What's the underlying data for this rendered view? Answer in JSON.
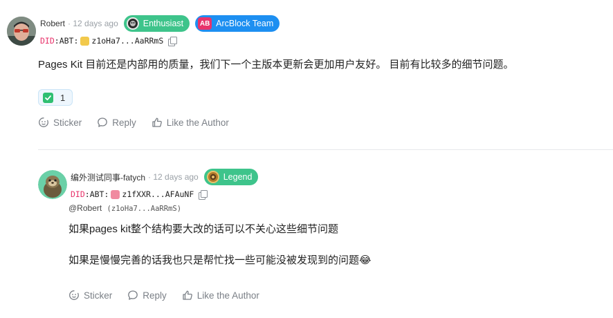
{
  "comment1": {
    "author": "Robert",
    "time": "· 12 days ago",
    "badges": [
      {
        "label": "Enthusiast",
        "color": "#3ec48b"
      },
      {
        "label": "ArcBlock Team",
        "color": "#1d8ff1",
        "icon_text": "AB"
      }
    ],
    "did": {
      "prefix": "DID",
      "middle": ":ABT:",
      "address": "z1oHa7...AaRRmS"
    },
    "body": "Pages Kit 目前还是内部用的质量，我们下一个主版本更新会更加用户友好。 目前有比较多的细节问题。",
    "reaction": {
      "icon": "check-mark-emoji",
      "count": "1"
    },
    "actions": {
      "sticker": "Sticker",
      "reply": "Reply",
      "like": "Like the Author"
    }
  },
  "comment2": {
    "author": "编外测试同事-fatych",
    "time": "· 12 days ago",
    "badges": [
      {
        "label": "Legend",
        "color": "#3ec48b"
      }
    ],
    "did": {
      "prefix": "DID",
      "middle": ":ABT:",
      "address": "z1fXXR...AFAuNF"
    },
    "mention": {
      "name": "@Robert",
      "did": "(z1oHa7...AaRRmS)"
    },
    "lines": [
      "如果pages kit整个结构要大改的话可以不关心这些细节问题",
      "如果是慢慢完善的话我也只是帮忙找一些可能没被发现到的问题😂"
    ],
    "actions": {
      "sticker": "Sticker",
      "reply": "Reply",
      "like": "Like the Author"
    }
  }
}
